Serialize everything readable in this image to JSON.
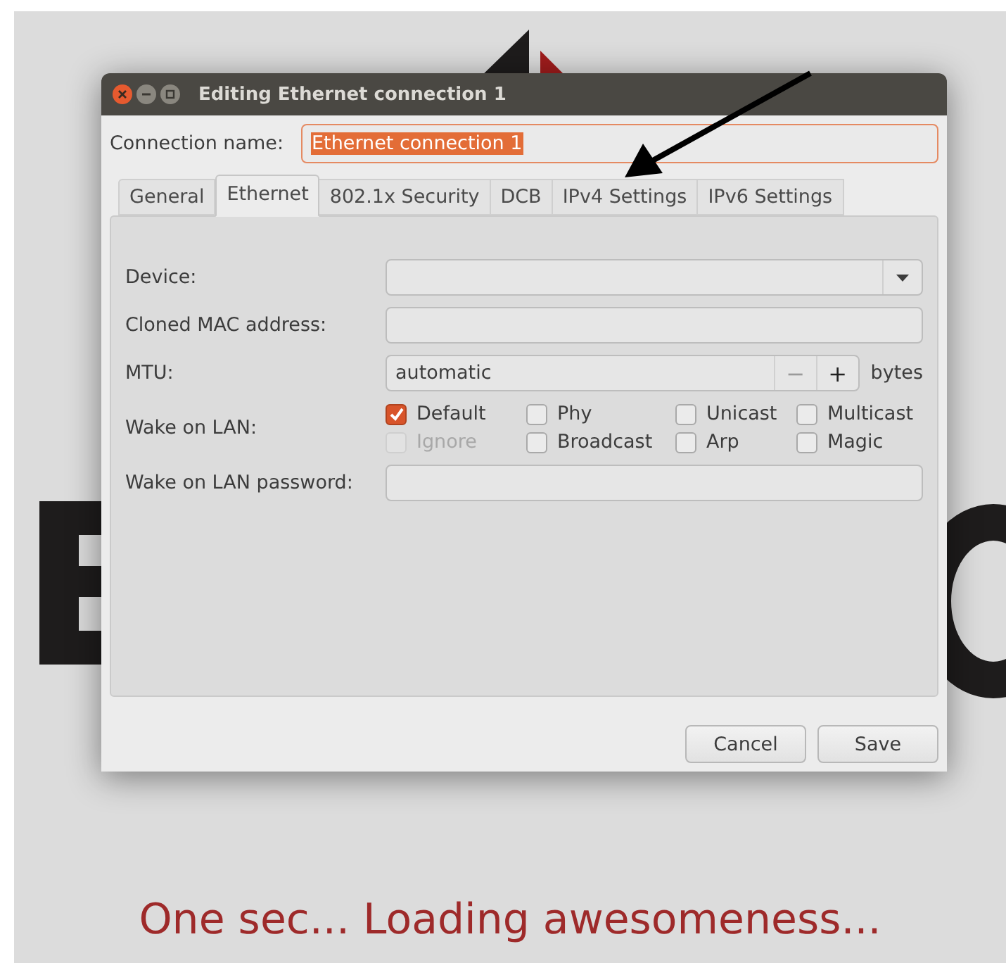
{
  "backdrop": {
    "loading_text": "One sec... Loading awesomeness..."
  },
  "window": {
    "title": "Editing Ethernet connection 1"
  },
  "connection_name": {
    "label": "Connection name:",
    "value": "Ethernet connection 1"
  },
  "tabs": [
    {
      "label": "General",
      "selected": false
    },
    {
      "label": "Ethernet",
      "selected": true
    },
    {
      "label": "802.1x Security",
      "selected": false
    },
    {
      "label": "DCB",
      "selected": false
    },
    {
      "label": "IPv4 Settings",
      "selected": false
    },
    {
      "label": "IPv6 Settings",
      "selected": false
    }
  ],
  "fields": [
    {
      "kind": "dropdown",
      "label": "Device:"
    },
    {
      "kind": "text",
      "label": "Cloned MAC address:"
    },
    {
      "kind": "spin",
      "label": "MTU:",
      "value": "automatic",
      "decrement": "−",
      "increment": "+",
      "unit": "bytes"
    },
    {
      "kind": "checkboxes",
      "label": "Wake on LAN:",
      "options": [
        {
          "label": "Default",
          "checked": true,
          "disabled": false
        },
        {
          "label": "Phy",
          "checked": false,
          "disabled": false
        },
        {
          "label": "Unicast",
          "checked": false,
          "disabled": false
        },
        {
          "label": "Multicast",
          "checked": false,
          "disabled": false
        },
        {
          "label": "Ignore",
          "checked": false,
          "disabled": true
        },
        {
          "label": "Broadcast",
          "checked": false,
          "disabled": false
        },
        {
          "label": "Arp",
          "checked": false,
          "disabled": false
        },
        {
          "label": "Magic",
          "checked": false,
          "disabled": false
        }
      ]
    },
    {
      "kind": "text",
      "label": "Wake on LAN password:"
    }
  ],
  "buttons": [
    "Cancel",
    "Save"
  ]
}
